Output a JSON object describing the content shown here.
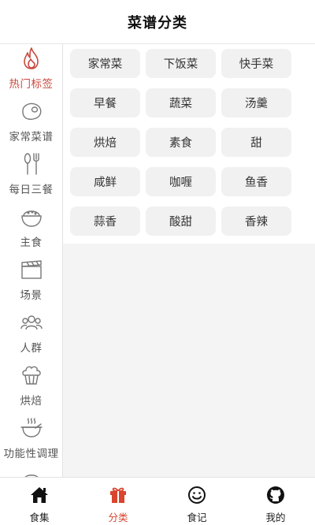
{
  "header": {
    "title": "菜谱分类"
  },
  "sidebar": {
    "items": [
      {
        "label": "热门标签",
        "icon": "flame-icon",
        "active": true
      },
      {
        "label": "家常菜谱",
        "icon": "steak-icon",
        "active": false
      },
      {
        "label": "每日三餐",
        "icon": "spoon-fork-icon",
        "active": false
      },
      {
        "label": "主食",
        "icon": "rice-bowl-icon",
        "active": false
      },
      {
        "label": "场景",
        "icon": "clapperboard-icon",
        "active": false
      },
      {
        "label": "人群",
        "icon": "people-icon",
        "active": false
      },
      {
        "label": "烘焙",
        "icon": "cupcake-icon",
        "active": false
      },
      {
        "label": "功能性调理",
        "icon": "soup-bowl-icon",
        "active": false
      }
    ]
  },
  "tags": [
    "家常菜",
    "下饭菜",
    "快手菜",
    "早餐",
    "蔬菜",
    "汤羹",
    "烘焙",
    "素食",
    "甜",
    "咸鲜",
    "咖喱",
    "鱼香",
    "蒜香",
    "酸甜",
    "香辣"
  ],
  "tabbar": {
    "items": [
      {
        "label": "食集",
        "icon": "home-icon",
        "active": false
      },
      {
        "label": "分类",
        "icon": "gift-icon",
        "active": true
      },
      {
        "label": "食记",
        "icon": "smile-icon",
        "active": false
      },
      {
        "label": "我的",
        "icon": "github-icon",
        "active": false
      }
    ]
  },
  "colors": {
    "accent": "#d9452f",
    "sidebar_active": "#c8493f",
    "tag_bg": "#f1f1f1",
    "content_bg": "#f4f4f4"
  }
}
